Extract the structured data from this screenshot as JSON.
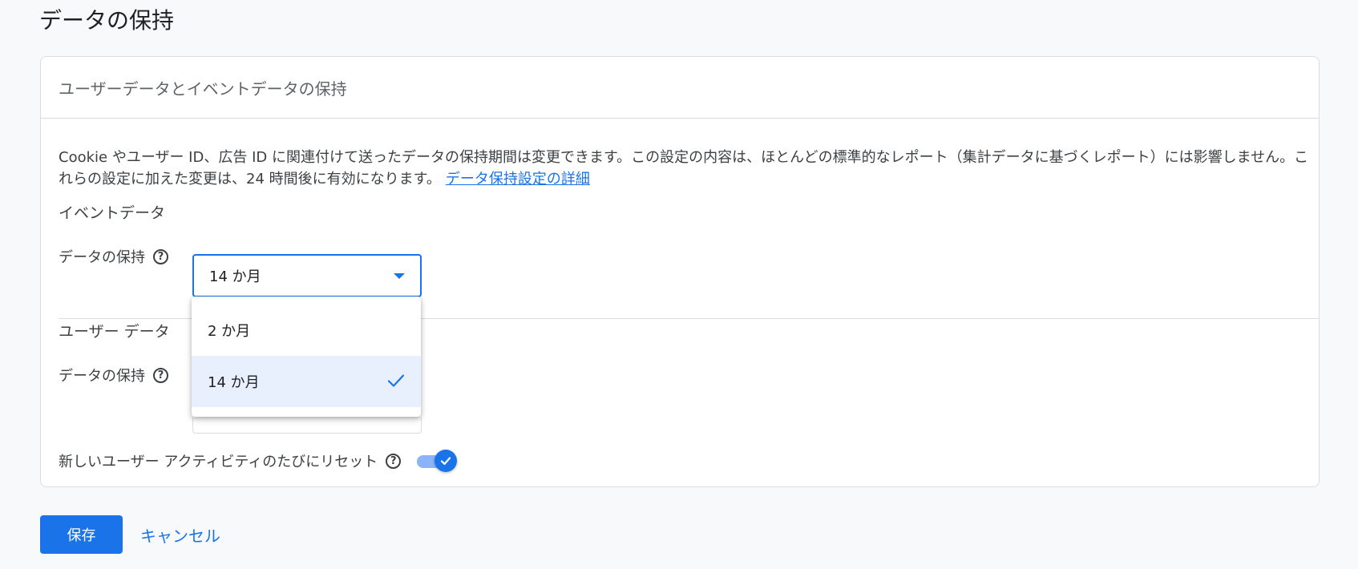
{
  "page": {
    "title": "データの保持"
  },
  "card": {
    "header": "ユーザーデータとイベントデータの保持",
    "description": "Cookie やユーザー ID、広告 ID に関連付けて送ったデータの保持期間は変更できます。この設定の内容は、ほとんどの標準的なレポート（集計データに基づくレポート）には影響しません。これらの設定に加えた変更は、24 時間後に有効になります。",
    "learn_more_link": "データ保持設定の詳細"
  },
  "event_data": {
    "section_title": "イベントデータ",
    "retention_label": "データの保持",
    "selected_value": "14 か月"
  },
  "user_data": {
    "section_title": "ユーザー データ",
    "retention_label": "データの保持"
  },
  "reset_toggle": {
    "label": "新しいユーザー アクティビティのたびにリセット",
    "enabled": true
  },
  "dropdown": {
    "options": [
      "2 か月",
      "14 か月"
    ],
    "selected": "14 か月"
  },
  "actions": {
    "save_label": "保存",
    "cancel_label": "キャンセル"
  },
  "help_icon_glyph": "?",
  "colors": {
    "accent": "#1a73e8",
    "selected_bg": "#e8f0fe"
  }
}
